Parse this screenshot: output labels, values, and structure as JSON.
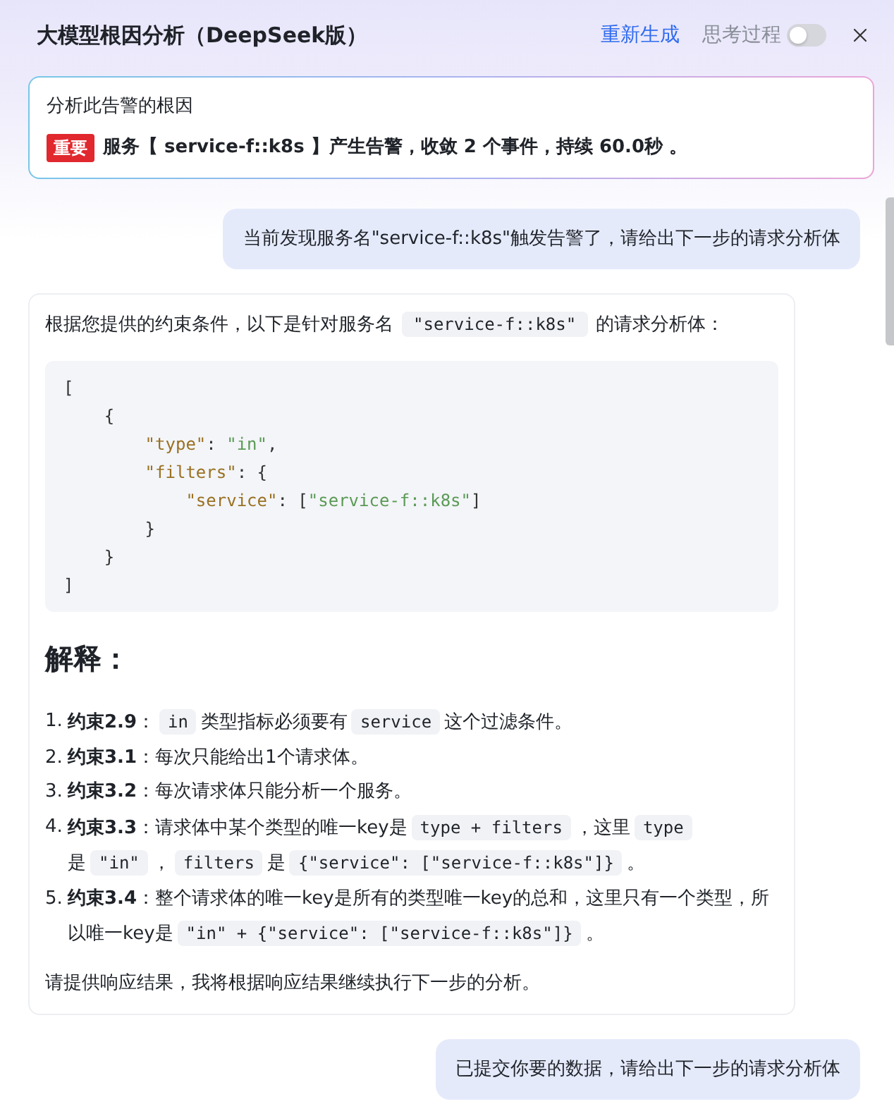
{
  "header": {
    "title": "大模型根因分析（DeepSeek版）",
    "regenerate_button": "重新生成",
    "thinking_toggle": {
      "label": "思考过程",
      "on": false
    }
  },
  "alert": {
    "prompt": "分析此告警的根因",
    "severity": "重要",
    "message": "服务【 service-f::k8s 】产生告警，收敛 2 个事件，持续 60.0秒 。"
  },
  "messages": [
    {
      "kind": "user",
      "text": "当前发现服务名\"service-f::k8s\"触发告警了，请给出下一步的请求分析体"
    },
    {
      "kind": "assistant",
      "intro": [
        {
          "kind": "text",
          "text": "根据您提供的约束条件，以下是针对服务名"
        },
        {
          "kind": "code",
          "text": "\"service-f::k8s\""
        },
        {
          "kind": "text",
          "text": "的请求分析体："
        }
      ],
      "code": [
        [
          {
            "kind": "punct",
            "text": "["
          }
        ],
        [
          {
            "kind": "punct",
            "text": "    {"
          }
        ],
        [
          {
            "kind": "key",
            "text": "        \"type\""
          },
          {
            "kind": "punct",
            "text": ": "
          },
          {
            "kind": "string",
            "text": "\"in\""
          },
          {
            "kind": "punct",
            "text": ","
          }
        ],
        [
          {
            "kind": "key",
            "text": "        \"filters\""
          },
          {
            "kind": "punct",
            "text": ": {"
          }
        ],
        [
          {
            "kind": "key",
            "text": "            \"service\""
          },
          {
            "kind": "punct",
            "text": ": ["
          },
          {
            "kind": "string",
            "text": "\"service-f::k8s\""
          },
          {
            "kind": "punct",
            "text": "]"
          }
        ],
        [
          {
            "kind": "punct",
            "text": "        }"
          }
        ],
        [
          {
            "kind": "punct",
            "text": "    }"
          }
        ],
        [
          {
            "kind": "punct",
            "text": "]"
          }
        ]
      ],
      "heading": "解释：",
      "items": [
        {
          "number": "1.",
          "parts": [
            {
              "kind": "text",
              "text": "**约束2.9**："
            },
            {
              "kind": "code",
              "text": "in"
            },
            {
              "kind": "text",
              "text": "类型指标必须要有"
            },
            {
              "kind": "code",
              "text": "service"
            },
            {
              "kind": "text",
              "text": "这个过滤条件。"
            }
          ]
        },
        {
          "number": "2.",
          "parts": [
            {
              "kind": "text",
              "text": "**约束3.1**：每次只能给出1个请求体。"
            }
          ]
        },
        {
          "number": "3.",
          "parts": [
            {
              "kind": "text",
              "text": "**约束3.2**：每次请求体只能分析一个服务。"
            }
          ]
        },
        {
          "number": "4.",
          "parts": [
            {
              "kind": "text",
              "text": "**约束3.3**：请求体中某个类型的唯一key是"
            },
            {
              "kind": "code",
              "text": "type + filters"
            },
            {
              "kind": "text",
              "text": "，这里"
            },
            {
              "kind": "code",
              "text": "type"
            },
            {
              "kind": "text",
              "text": "是"
            },
            {
              "kind": "code",
              "text": "\"in\""
            },
            {
              "kind": "text",
              "text": "，"
            },
            {
              "kind": "code",
              "text": "filters"
            },
            {
              "kind": "text",
              "text": "是"
            },
            {
              "kind": "code",
              "text": "{\"service\": [\"service-f::k8s\"]}"
            },
            {
              "kind": "text",
              "text": "。"
            }
          ]
        },
        {
          "number": "5.",
          "parts": [
            {
              "kind": "text",
              "text": "**约束3.4**：整个请求体的唯一key是所有的类型唯一key的总和，这里只有一个类型，所以唯一key是"
            },
            {
              "kind": "code",
              "text": "\"in\" + {\"service\": [\"service-f::k8s\"]}"
            },
            {
              "kind": "text",
              "text": "。"
            }
          ]
        }
      ],
      "closing": "请提供响应结果，我将根据响应结果继续执行下一步的分析。"
    },
    {
      "kind": "user",
      "text": "已提交你要的数据，请给出下一步的请求分析体"
    }
  ]
}
